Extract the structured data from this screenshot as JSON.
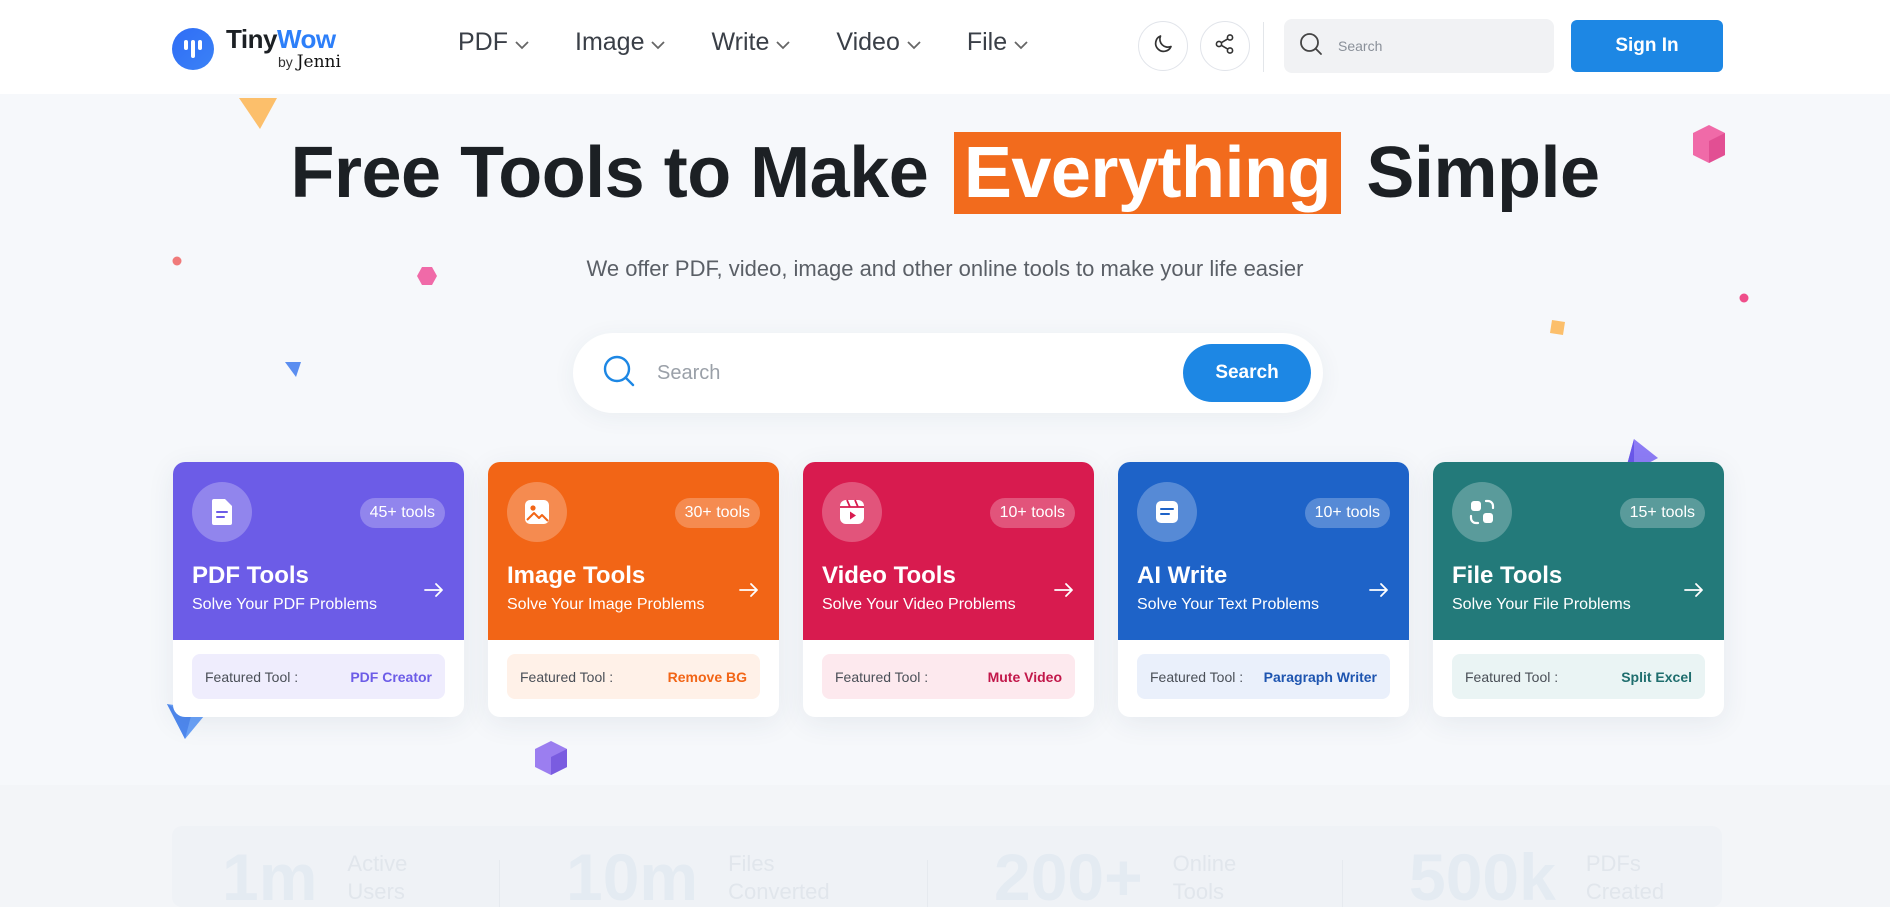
{
  "brand": {
    "title_part1": "Tiny",
    "title_part2": "Wow",
    "byline": "by",
    "byline_name": "Jenni",
    "accent_color": "#2d7ff9"
  },
  "nav": [
    {
      "label": "PDF",
      "icon": "chevron-down-icon"
    },
    {
      "label": "Image",
      "icon": "chevron-down-icon"
    },
    {
      "label": "Write",
      "icon": "chevron-down-icon"
    },
    {
      "label": "Video",
      "icon": "chevron-down-icon"
    },
    {
      "label": "File",
      "icon": "chevron-down-icon"
    }
  ],
  "header_actions": {
    "theme_icon": "moon-icon",
    "share_icon": "share-icon",
    "search_placeholder": "Search",
    "signin_label": "Sign In",
    "signin_color": "#1d87e4"
  },
  "hero": {
    "title_before": "Free Tools to Make",
    "title_highlight": "Everything",
    "title_after": "Simple",
    "highlight_color": "#f26b1d",
    "subtitle": "We offer PDF, video, image and other online tools to make your life easier",
    "search_placeholder": "Search",
    "search_button": "Search"
  },
  "cards": [
    {
      "title": "PDF Tools",
      "desc": "Solve Your PDF Problems",
      "badge": "45+ tools",
      "featured_label": "Featured Tool :",
      "featured_value": "PDF Creator",
      "color": "#6c5ce7",
      "icon": "document-icon"
    },
    {
      "title": "Image Tools",
      "desc": "Solve Your Image Problems",
      "badge": "30+ tools",
      "featured_label": "Featured Tool :",
      "featured_value": "Remove BG",
      "color": "#f26516",
      "icon": "image-icon"
    },
    {
      "title": "Video Tools",
      "desc": "Solve Your Video Problems",
      "badge": "10+ tools",
      "featured_label": "Featured Tool :",
      "featured_value": "Mute Video",
      "color": "#d81b4f",
      "icon": "video-icon"
    },
    {
      "title": "AI Write",
      "desc": "Solve Your Text Problems",
      "badge": "10+ tools",
      "featured_label": "Featured Tool :",
      "featured_value": "Paragraph Writer",
      "color": "#1e63c8",
      "icon": "note-icon"
    },
    {
      "title": "File Tools",
      "desc": "Solve Your File Problems",
      "badge": "15+ tools",
      "featured_label": "Featured Tool :",
      "featured_value": "Split Excel",
      "color": "#237a7a",
      "icon": "file-convert-icon"
    }
  ],
  "stats": [
    {
      "value": "1m",
      "label_line1": "Active",
      "label_line2": "Users"
    },
    {
      "value": "10m",
      "label_line1": "Files",
      "label_line2": "Converted"
    },
    {
      "value": "200+",
      "label_line1": "Online",
      "label_line2": "Tools"
    },
    {
      "value": "500k",
      "label_line1": "PDFs",
      "label_line2": "Created"
    }
  ]
}
